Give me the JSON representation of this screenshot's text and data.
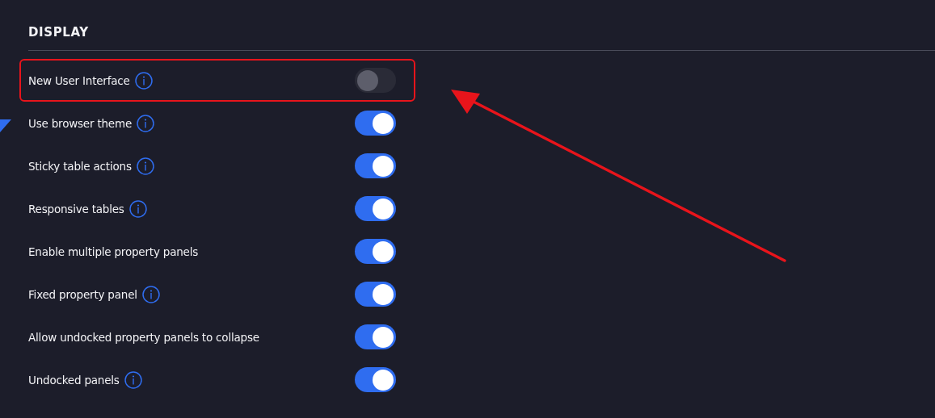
{
  "section": {
    "title": "DISPLAY"
  },
  "settings": [
    {
      "label": "New User Interface",
      "info": true,
      "on": false,
      "highlighted": true
    },
    {
      "label": "Use browser theme",
      "info": true,
      "on": true,
      "highlighted": false
    },
    {
      "label": "Sticky table actions",
      "info": true,
      "on": true,
      "highlighted": false
    },
    {
      "label": "Responsive tables",
      "info": true,
      "on": true,
      "highlighted": false
    },
    {
      "label": "Enable multiple property panels",
      "info": false,
      "on": true,
      "highlighted": false
    },
    {
      "label": "Fixed property panel",
      "info": true,
      "on": true,
      "highlighted": false
    },
    {
      "label": "Allow undocked property panels to collapse",
      "info": false,
      "on": true,
      "highlighted": false
    },
    {
      "label": "Undocked panels",
      "info": true,
      "on": true,
      "highlighted": false
    }
  ]
}
